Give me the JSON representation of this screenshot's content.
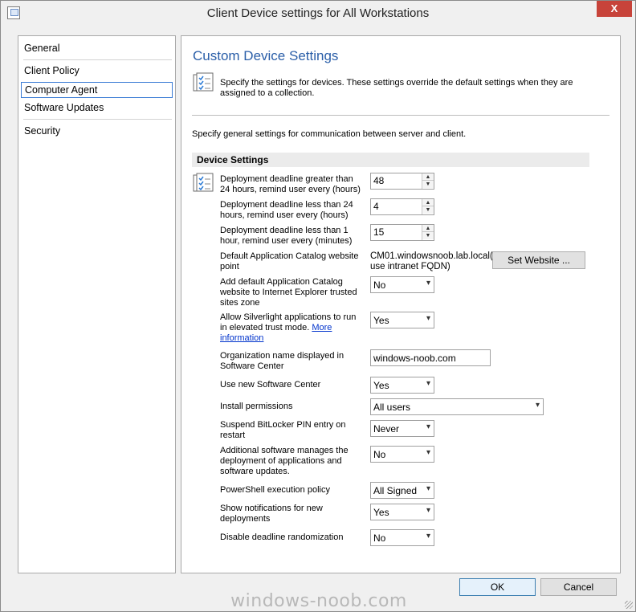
{
  "window": {
    "title": "Client Device settings for All Workstations",
    "close_symbol": "X"
  },
  "nav": {
    "items": [
      {
        "label": "General"
      },
      {
        "label": "Client Policy"
      },
      {
        "label": "Computer Agent",
        "selected": true
      },
      {
        "label": "Software Updates"
      },
      {
        "label": "Security"
      }
    ]
  },
  "content": {
    "heading": "Custom Device Settings",
    "intro": "Specify the settings for devices. These settings override the default settings when they are assigned to a collection.",
    "general_text": "Specify general settings for communication between server and client.",
    "section_title": "Device Settings",
    "settings": {
      "deadline_gt24": {
        "label": "Deployment deadline greater than 24 hours, remind user every (hours)",
        "value": "48"
      },
      "deadline_lt24": {
        "label": "Deployment deadline less than 24 hours, remind user every (hours)",
        "value": "4"
      },
      "deadline_lt1": {
        "label": "Deployment deadline less than 1 hour, remind user every (minutes)",
        "value": "15"
      },
      "app_catalog": {
        "label": "Default Application Catalog website point",
        "value": "CM01.windowsnoob.lab.local( use intranet FQDN)",
        "button": "Set Website ..."
      },
      "ie_trusted": {
        "label": "Add default Application Catalog website to Internet Explorer trusted sites zone",
        "value": "No"
      },
      "silverlight": {
        "label": "Allow Silverlight applications to run in elevated trust mode.",
        "link": "More information",
        "value": "Yes"
      },
      "org_name": {
        "label": "Organization name displayed in Software Center",
        "value": "windows-noob.com"
      },
      "new_sc": {
        "label": "Use new Software Center",
        "value": "Yes"
      },
      "install_permissions": {
        "label": "Install permissions",
        "value": "All users"
      },
      "bitlocker": {
        "label": "Suspend BitLocker PIN entry on restart",
        "value": "Never"
      },
      "additional_sw": {
        "label": "Additional software manages the deployment of applications and software updates.",
        "value": "No"
      },
      "powershell": {
        "label": "PowerShell execution policy",
        "value": "All Signed"
      },
      "notifications": {
        "label": "Show notifications for new deployments",
        "value": "Yes"
      },
      "randomization": {
        "label": "Disable deadline randomization",
        "value": "No"
      }
    }
  },
  "footer": {
    "ok_label": "OK",
    "cancel_label": "Cancel"
  },
  "watermark": "windows-noob.com",
  "icons": {
    "title": "app-window-icon",
    "intro": "settings-document-icon",
    "section": "settings-document-icon"
  },
  "colors": {
    "heading": "#2a5ea8",
    "link": "#0033cc",
    "close": "#c7433a"
  }
}
